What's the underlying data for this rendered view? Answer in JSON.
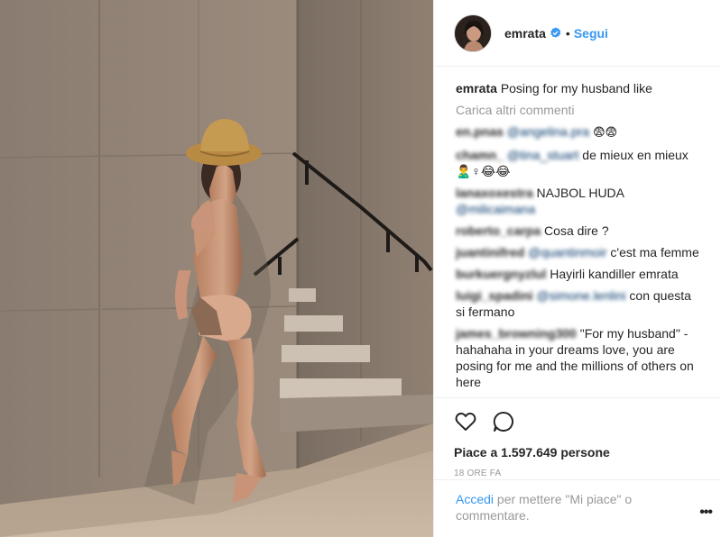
{
  "post": {
    "username": "emrata",
    "follow_label": "Segui",
    "dot": "•",
    "caption": "Posing for my husband like",
    "load_more": "Carica altri commenti"
  },
  "comments": [
    {
      "user": "en.pnas",
      "mention": "@angelina.pra",
      "text": "😨😨"
    },
    {
      "user": "chamn_",
      "mention": "@tina_stuart",
      "text": " de mieux en mieux 🙎‍♂️♀😂😂"
    },
    {
      "user": "lanaxoxestra",
      "text": " NAJBOL HUDA",
      "mention2": "@milicaimana"
    },
    {
      "user": "roberto_carpa",
      "text": " Cosa dire ?"
    },
    {
      "user": "juantinifred",
      "mention": "@quantinmoir",
      "text": " c'est ma femme"
    },
    {
      "user": "burkuergnyzlul",
      "text": " Hayirli kandiller emrata"
    },
    {
      "user": "luigi_spadini",
      "mention": "@simone.lenlini",
      "text": " con questa si fermano"
    },
    {
      "user": "james_browning300",
      "text": " \"For my husband\" - hahahaha in your dreams love, you are posing for me and the millions of others on here"
    }
  ],
  "actions": {
    "likes": "Piace a 1.597.649 persone",
    "time": "18 ORE FA"
  },
  "login": {
    "link": "Accedi",
    "text": " per mettere \"Mi piace\" o commentare."
  },
  "more_label": "•••",
  "icons": [
    "heart-icon",
    "comment-icon",
    "verified-badge-icon",
    "more-options-icon"
  ],
  "colors": {
    "link": "#3897f0",
    "muted": "#999999",
    "text": "#262626",
    "mention": "#003569"
  }
}
